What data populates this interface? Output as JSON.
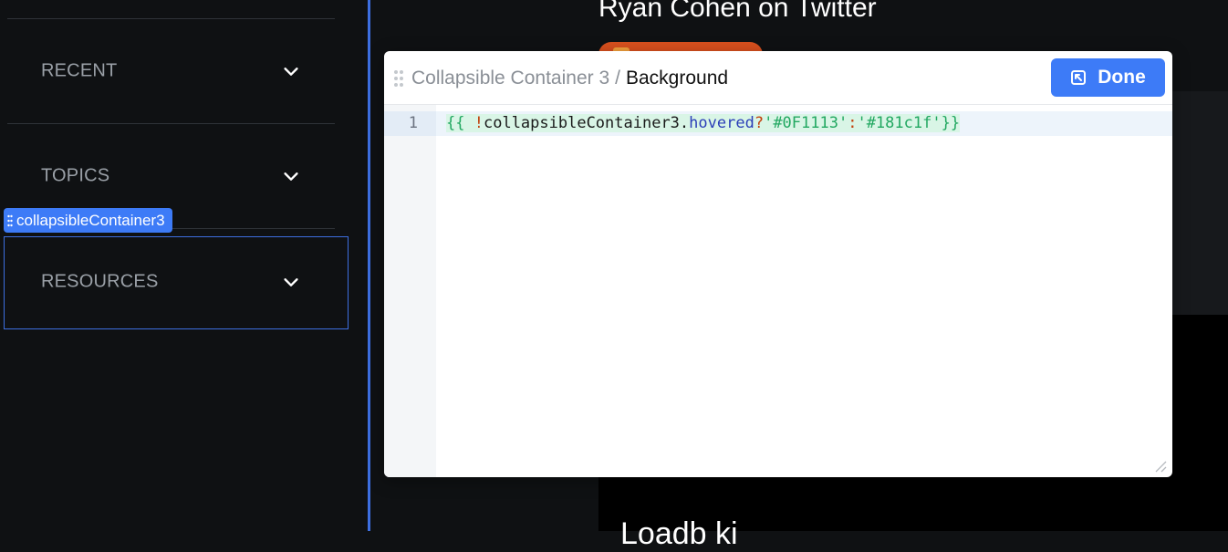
{
  "sidebar": {
    "items": [
      {
        "label": "RECENT"
      },
      {
        "label": "TOPICS"
      },
      {
        "label": "RESOURCES"
      }
    ],
    "selected_component_tag": "collapsibleContainer3",
    "accent_color": "#3d6fe0"
  },
  "background_app": {
    "title": "Ryan Cohen on Twitter",
    "partial_text": "Loadb ki"
  },
  "editor": {
    "breadcrumb": {
      "parent": "Collapsible Container 3",
      "separator": "/",
      "current": "Background"
    },
    "done_label": "Done",
    "line_number": "1",
    "code": {
      "open": "{{",
      "bang": "!",
      "ident": "collapsibleContainer3",
      "dot": ".",
      "prop": "hovered",
      "q": "?",
      "str1": "'#0F1113'",
      "colon": ":",
      "str2": "'#181c1f'",
      "close": "}}"
    },
    "accent_color": "#3d7bf7"
  }
}
